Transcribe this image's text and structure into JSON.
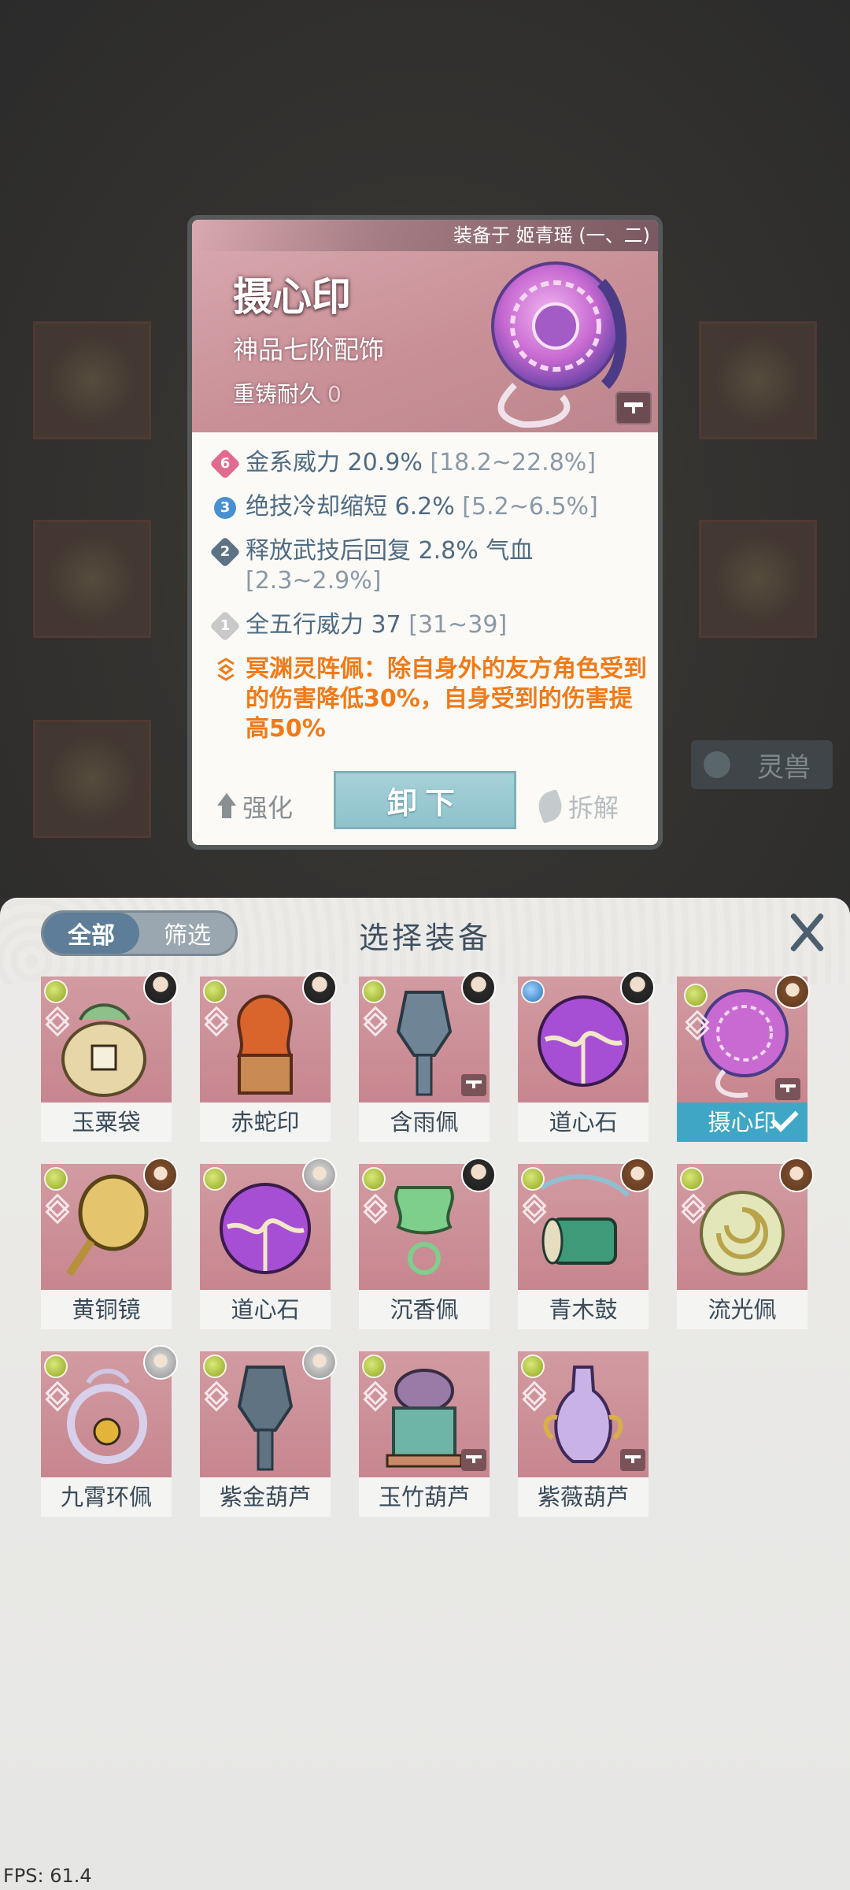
{
  "detail": {
    "equipped_on": "装备于 姬青瑶 (一、二)",
    "name": "摄心印",
    "grade": "神品七阶配饰",
    "durability_label": "重铸耐久",
    "durability_value": "0",
    "stats": [
      {
        "badge": "6",
        "text": "金系威力 20.9% ",
        "range": "[18.2~22.8%]"
      },
      {
        "badge": "3",
        "text": "绝技冷却缩短 6.2% ",
        "range": "[5.2~6.5%]"
      },
      {
        "badge": "2",
        "text": "释放武技后回复 2.8% 气血 ",
        "range": "[2.3~2.9%]"
      },
      {
        "badge": "1",
        "text": "全五行威力 37 ",
        "range": "[31~39]"
      }
    ],
    "special": "冥渊灵阵佩：除自身外的友方角色受到的伤害降低30%，自身受到的伤害提高50%",
    "actions": {
      "strengthen": "强化",
      "unequip": "卸下",
      "dismantle": "拆解"
    }
  },
  "background": {
    "spirit_tab": "灵兽"
  },
  "panel": {
    "title": "选择装备",
    "filter_all": "全部",
    "filter_screen": "筛选",
    "items": [
      {
        "name": "玉粟袋",
        "art": "pouch-icon"
      },
      {
        "name": "赤蛇印",
        "art": "seal-icon"
      },
      {
        "name": "含雨佩",
        "art": "pendant-icon"
      },
      {
        "name": "道心石",
        "art": "orb-icon"
      },
      {
        "name": "摄心印",
        "art": "mind-seal-icon",
        "selected": true
      },
      {
        "name": "黄铜镜",
        "art": "mirror-icon"
      },
      {
        "name": "道心石",
        "art": "orb-icon"
      },
      {
        "name": "沉香佩",
        "art": "jade-pendant-icon"
      },
      {
        "name": "青木鼓",
        "art": "drum-icon"
      },
      {
        "name": "流光佩",
        "art": "disc-icon"
      },
      {
        "name": "九霄环佩",
        "art": "ring-pendant-icon"
      },
      {
        "name": "紫金葫芦",
        "art": "gourd-icon"
      },
      {
        "name": "玉竹葫芦",
        "art": "censer-icon"
      },
      {
        "name": "紫薇葫芦",
        "art": "vase-icon"
      }
    ]
  },
  "fps": "FPS: 61.4"
}
